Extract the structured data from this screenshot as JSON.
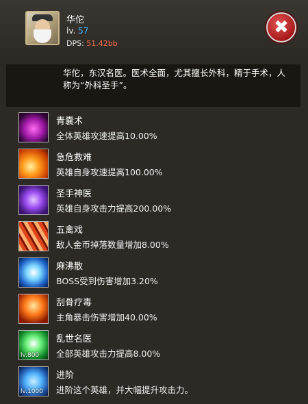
{
  "hero": {
    "name": "华佗",
    "level_prefix": "lv.",
    "level": "57",
    "dps_prefix": "DPS:",
    "dps": "51.42bb"
  },
  "description": "华佗，东汉名医。医术全面，尤其擅长外科，精于手术，人称为“外科圣手”。",
  "skills": [
    {
      "name": "青囊术",
      "effect": "全体英雄攻速提高10.00%",
      "icon": "dark-hand-skill-icon"
    },
    {
      "name": "急危救难",
      "effect": "英雄自身攻速提高100.00%",
      "icon": "flame-skill-icon"
    },
    {
      "name": "圣手神医",
      "effect": "英雄自身攻击力提高200.00%",
      "icon": "purple-aura-skill-icon"
    },
    {
      "name": "五禽戏",
      "effect": "敌人金币掉落数量增加8.00%",
      "icon": "fire-claw-skill-icon"
    },
    {
      "name": "麻沸散",
      "effect": "BOSS受到伤害增加3.20%",
      "icon": "ice-burst-skill-icon"
    },
    {
      "name": "刮骨疗毒",
      "effect": "主角暴击伤害增加40.00%",
      "icon": "fire-figure-skill-icon"
    },
    {
      "name": "乱世名医",
      "effect": "全部英雄攻击力提高8.00%",
      "icon": "green-figure-skill-icon",
      "icon_label": "lv.800"
    },
    {
      "name": "进阶",
      "effect": "进阶这个英雄，并大幅提升攻击力。",
      "icon": "advance-skill-icon",
      "icon_label": "lv.1000"
    }
  ],
  "colors": {
    "level": "#42b5ff",
    "dps": "#ff6c4d",
    "close": "#c42222"
  }
}
